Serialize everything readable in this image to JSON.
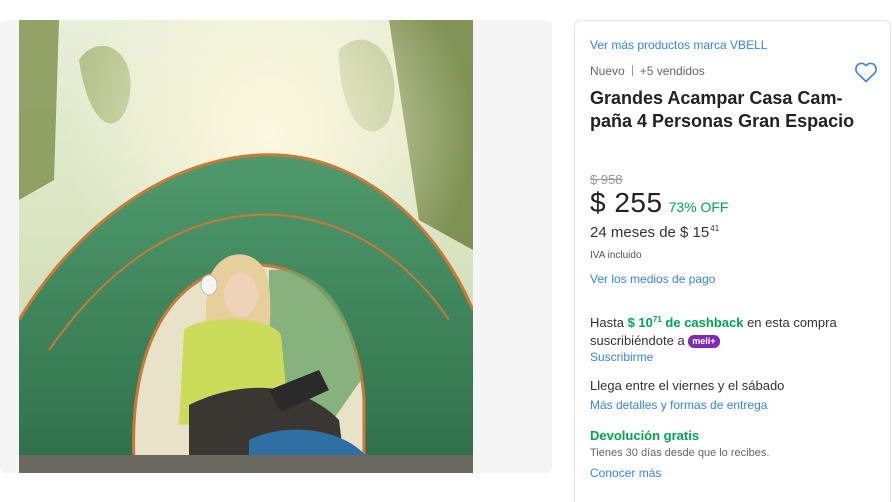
{
  "brand_link": "Ver más productos marca VBELL",
  "condition": {
    "state": "Nuevo",
    "sold": "+5 vendidos"
  },
  "title": "Grandes Acampar Casa Cam-paña 4 Personas Gran Espacio",
  "price": {
    "original": "$ 958",
    "current": "$ 255",
    "discount": "73% OFF",
    "installments_prefix": "24 meses de $ 15",
    "installments_cents": "41",
    "tax_note": "IVA incluido",
    "payment_link": "Ver los medios de pago"
  },
  "cashback": {
    "prefix": "Hasta ",
    "amount": "$ 10",
    "amount_cents": "71",
    "middle": " de cashback",
    "suffix": " en esta compra suscribiéndote a ",
    "badge": "meli+",
    "subscribe_link": "Suscribirme"
  },
  "delivery": {
    "text": "Llega entre el viernes y el sábado",
    "link": "Más detalles y formas de entrega"
  },
  "returns": {
    "title": "Devolución gratis",
    "subtitle": "Tienes 30 días desde que lo recibes.",
    "link": "Conocer más"
  },
  "colors": {
    "link": "#3483fa",
    "green": "#00a650",
    "meli_plus": "#7f2bb8"
  },
  "icons": {
    "favorite": "heart-outline-icon"
  }
}
